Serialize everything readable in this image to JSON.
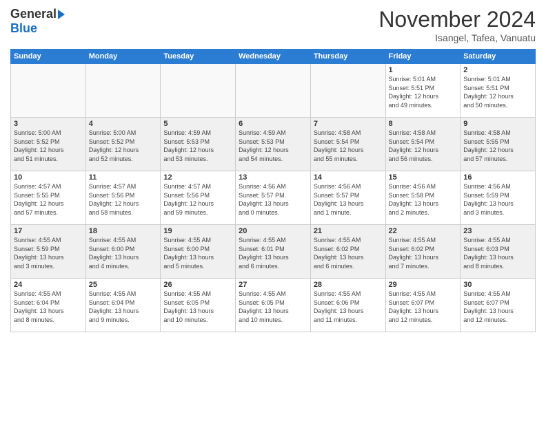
{
  "header": {
    "logo_general": "General",
    "logo_blue": "Blue",
    "title": "November 2024",
    "subtitle": "Isangel, Tafea, Vanuatu"
  },
  "days_of_week": [
    "Sunday",
    "Monday",
    "Tuesday",
    "Wednesday",
    "Thursday",
    "Friday",
    "Saturday"
  ],
  "weeks": [
    [
      {
        "day": "",
        "info": ""
      },
      {
        "day": "",
        "info": ""
      },
      {
        "day": "",
        "info": ""
      },
      {
        "day": "",
        "info": ""
      },
      {
        "day": "",
        "info": ""
      },
      {
        "day": "1",
        "info": "Sunrise: 5:01 AM\nSunset: 5:51 PM\nDaylight: 12 hours\nand 49 minutes."
      },
      {
        "day": "2",
        "info": "Sunrise: 5:01 AM\nSunset: 5:51 PM\nDaylight: 12 hours\nand 50 minutes."
      }
    ],
    [
      {
        "day": "3",
        "info": "Sunrise: 5:00 AM\nSunset: 5:52 PM\nDaylight: 12 hours\nand 51 minutes."
      },
      {
        "day": "4",
        "info": "Sunrise: 5:00 AM\nSunset: 5:52 PM\nDaylight: 12 hours\nand 52 minutes."
      },
      {
        "day": "5",
        "info": "Sunrise: 4:59 AM\nSunset: 5:53 PM\nDaylight: 12 hours\nand 53 minutes."
      },
      {
        "day": "6",
        "info": "Sunrise: 4:59 AM\nSunset: 5:53 PM\nDaylight: 12 hours\nand 54 minutes."
      },
      {
        "day": "7",
        "info": "Sunrise: 4:58 AM\nSunset: 5:54 PM\nDaylight: 12 hours\nand 55 minutes."
      },
      {
        "day": "8",
        "info": "Sunrise: 4:58 AM\nSunset: 5:54 PM\nDaylight: 12 hours\nand 56 minutes."
      },
      {
        "day": "9",
        "info": "Sunrise: 4:58 AM\nSunset: 5:55 PM\nDaylight: 12 hours\nand 57 minutes."
      }
    ],
    [
      {
        "day": "10",
        "info": "Sunrise: 4:57 AM\nSunset: 5:55 PM\nDaylight: 12 hours\nand 57 minutes."
      },
      {
        "day": "11",
        "info": "Sunrise: 4:57 AM\nSunset: 5:56 PM\nDaylight: 12 hours\nand 58 minutes."
      },
      {
        "day": "12",
        "info": "Sunrise: 4:57 AM\nSunset: 5:56 PM\nDaylight: 12 hours\nand 59 minutes."
      },
      {
        "day": "13",
        "info": "Sunrise: 4:56 AM\nSunset: 5:57 PM\nDaylight: 13 hours\nand 0 minutes."
      },
      {
        "day": "14",
        "info": "Sunrise: 4:56 AM\nSunset: 5:57 PM\nDaylight: 13 hours\nand 1 minute."
      },
      {
        "day": "15",
        "info": "Sunrise: 4:56 AM\nSunset: 5:58 PM\nDaylight: 13 hours\nand 2 minutes."
      },
      {
        "day": "16",
        "info": "Sunrise: 4:56 AM\nSunset: 5:59 PM\nDaylight: 13 hours\nand 3 minutes."
      }
    ],
    [
      {
        "day": "17",
        "info": "Sunrise: 4:55 AM\nSunset: 5:59 PM\nDaylight: 13 hours\nand 3 minutes."
      },
      {
        "day": "18",
        "info": "Sunrise: 4:55 AM\nSunset: 6:00 PM\nDaylight: 13 hours\nand 4 minutes."
      },
      {
        "day": "19",
        "info": "Sunrise: 4:55 AM\nSunset: 6:00 PM\nDaylight: 13 hours\nand 5 minutes."
      },
      {
        "day": "20",
        "info": "Sunrise: 4:55 AM\nSunset: 6:01 PM\nDaylight: 13 hours\nand 6 minutes."
      },
      {
        "day": "21",
        "info": "Sunrise: 4:55 AM\nSunset: 6:02 PM\nDaylight: 13 hours\nand 6 minutes."
      },
      {
        "day": "22",
        "info": "Sunrise: 4:55 AM\nSunset: 6:02 PM\nDaylight: 13 hours\nand 7 minutes."
      },
      {
        "day": "23",
        "info": "Sunrise: 4:55 AM\nSunset: 6:03 PM\nDaylight: 13 hours\nand 8 minutes."
      }
    ],
    [
      {
        "day": "24",
        "info": "Sunrise: 4:55 AM\nSunset: 6:04 PM\nDaylight: 13 hours\nand 8 minutes."
      },
      {
        "day": "25",
        "info": "Sunrise: 4:55 AM\nSunset: 6:04 PM\nDaylight: 13 hours\nand 9 minutes."
      },
      {
        "day": "26",
        "info": "Sunrise: 4:55 AM\nSunset: 6:05 PM\nDaylight: 13 hours\nand 10 minutes."
      },
      {
        "day": "27",
        "info": "Sunrise: 4:55 AM\nSunset: 6:05 PM\nDaylight: 13 hours\nand 10 minutes."
      },
      {
        "day": "28",
        "info": "Sunrise: 4:55 AM\nSunset: 6:06 PM\nDaylight: 13 hours\nand 11 minutes."
      },
      {
        "day": "29",
        "info": "Sunrise: 4:55 AM\nSunset: 6:07 PM\nDaylight: 13 hours\nand 12 minutes."
      },
      {
        "day": "30",
        "info": "Sunrise: 4:55 AM\nSunset: 6:07 PM\nDaylight: 13 hours\nand 12 minutes."
      }
    ]
  ]
}
